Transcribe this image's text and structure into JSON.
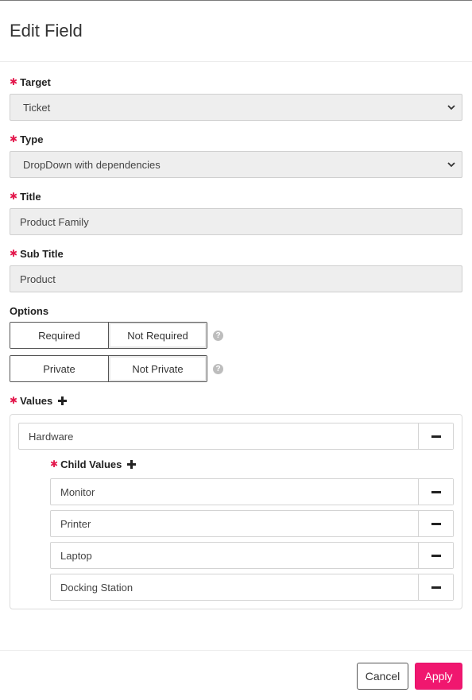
{
  "dialog": {
    "title": "Edit Field"
  },
  "required_mark": "✱",
  "fields": {
    "target": {
      "label": "Target",
      "value": "Ticket"
    },
    "type": {
      "label": "Type",
      "value": "DropDown with dependencies"
    },
    "title": {
      "label": "Title",
      "value": "Product Family"
    },
    "subtitle": {
      "label": "Sub Title",
      "value": "Product"
    }
  },
  "options": {
    "label": "Options",
    "required_toggle": {
      "left": "Required",
      "right": "Not Required",
      "selected": "Not Required"
    },
    "private_toggle": {
      "left": "Private",
      "right": "Not Private",
      "selected": "Not Private"
    },
    "help_glyph": "?"
  },
  "values": {
    "label": "Values",
    "items": [
      {
        "value": "Hardware",
        "child_label": "Child Values",
        "children": [
          "Monitor",
          "Printer",
          "Laptop",
          "Docking Station"
        ]
      }
    ]
  },
  "footer": {
    "cancel_label": "Cancel",
    "apply_label": "Apply"
  },
  "colors": {
    "accent": "#f0176f",
    "required": "#e3194d"
  },
  "icons": {
    "select": "chevron-down-icon",
    "add": "plus-icon",
    "remove": "minus-icon",
    "help": "help-icon"
  }
}
